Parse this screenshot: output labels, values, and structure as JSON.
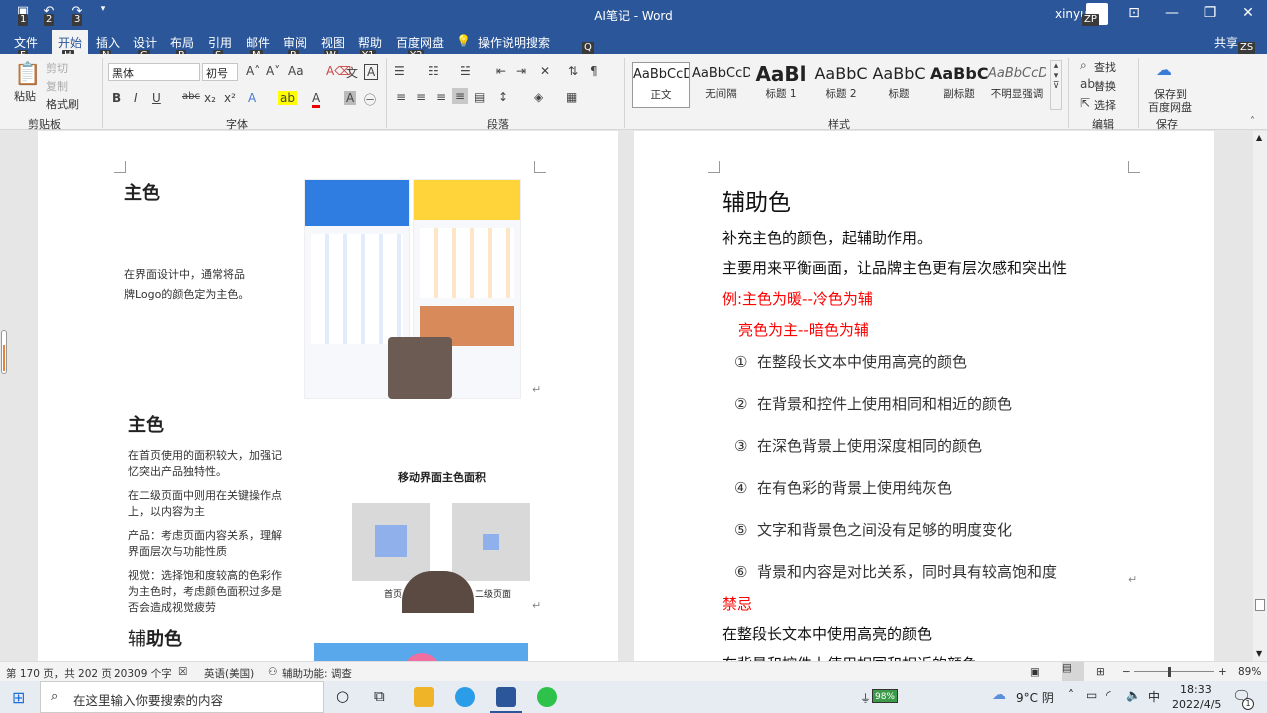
{
  "window": {
    "doc_title": "AI笔记 - Word",
    "user_name": "xinyu",
    "user_initials": "ZP"
  },
  "quick_access": {
    "keytips": [
      "1",
      "2",
      "3"
    ]
  },
  "tabs": [
    {
      "label": "文件",
      "keytip": "F"
    },
    {
      "label": "开始",
      "keytip": "H"
    },
    {
      "label": "插入",
      "keytip": "N"
    },
    {
      "label": "设计",
      "keytip": "G"
    },
    {
      "label": "布局",
      "keytip": "P"
    },
    {
      "label": "引用",
      "keytip": "S"
    },
    {
      "label": "邮件",
      "keytip": "M"
    },
    {
      "label": "审阅",
      "keytip": "R"
    },
    {
      "label": "视图",
      "keytip": "W"
    },
    {
      "label": "帮助",
      "keytip": "Y1"
    },
    {
      "label": "百度网盘",
      "keytip": "Y2"
    }
  ],
  "tell_me": {
    "label": "操作说明搜索",
    "keytip": "Q"
  },
  "share": {
    "label": "共享",
    "keytip": "ZS"
  },
  "ribbon": {
    "clipboard": {
      "group": "剪贴板",
      "paste": "粘贴",
      "cut": "剪切",
      "copy": "复制",
      "format_painter": "格式刷"
    },
    "font": {
      "group": "字体",
      "family": "黑体",
      "size": "初号"
    },
    "paragraph": {
      "group": "段落"
    },
    "styles": {
      "group": "样式",
      "items": [
        {
          "preview": "AaBbCcDd",
          "name": "正文"
        },
        {
          "preview": "AaBbCcDd",
          "name": "无间隔"
        },
        {
          "preview": "AaBl",
          "name": "标题 1"
        },
        {
          "preview": "AaBbC",
          "name": "标题 2"
        },
        {
          "preview": "AaBbC",
          "name": "标题"
        },
        {
          "preview": "AaBbC",
          "name": "副标题"
        },
        {
          "preview": "AaBbCcDd",
          "name": "不明显强调"
        }
      ]
    },
    "editing": {
      "group": "编辑",
      "find": "查找",
      "replace": "替换",
      "select": "选择"
    },
    "save": {
      "group": "保存",
      "label_line1": "保存到",
      "label_line2": "百度网盘"
    }
  },
  "page1": {
    "heading1": "主色",
    "text1_line1": "在界面设计中，通常将品",
    "text1_line2": "牌Logo的颜色定为主色。",
    "heading2": "主色",
    "p1_line1": "在首页使用的面积较大，加强记",
    "p1_line2": "忆突出产品独特性。",
    "p2_line1": "在二级页面中则用在关键操作点",
    "p2_line2": "上，以内容为主",
    "p3_line1": "产品：考虑页面内容关系，理解",
    "p3_line2": "界面层次与功能性质",
    "p4_line1": "视觉：选择饱和度较高的色彩作",
    "p4_line2": "为主色时，考虑颜色面积过多是",
    "p4_line3": "否会造成视觉疲劳",
    "diagram_title": "移动界面主色面积",
    "diagram_left_label": "首页",
    "diagram_right_label": "二级页面",
    "heading3_prefix": "辅",
    "heading3_suffix": "助色"
  },
  "page2": {
    "title": "辅助色",
    "line1": "补充主色的颜色，起辅助作用。",
    "line2": "主要用来平衡画面，让品牌主色更有层次感和突出性",
    "line3": "例:主色为暖--冷色为辅",
    "line4": "亮色为主--暗色为辅",
    "items": [
      {
        "num": "①",
        "text": "在整段长文本中使用高亮的颜色"
      },
      {
        "num": "②",
        "text": "在背景和控件上使用相同和相近的颜色"
      },
      {
        "num": "③",
        "text": "在深色背景上使用深度相同的颜色"
      },
      {
        "num": "④",
        "text": "在有色彩的背景上使用纯灰色"
      },
      {
        "num": "⑤",
        "text": "文字和背景色之间没有足够的明度变化"
      },
      {
        "num": "⑥",
        "text": "背景和内容是对比关系，同时具有较高饱和度"
      }
    ],
    "taboo": "禁忌",
    "line_after1": "在整段长文本中使用高亮的颜色",
    "line_after2": "在背景和控件上使用相同和相近的颜色",
    "red_color": "#ff0000"
  },
  "status": {
    "page": "第 170 页，共 202 页",
    "words": "20309 个字",
    "language": "英语(美国)",
    "accessibility": "辅助功能: 调查",
    "zoom": "89%"
  },
  "taskbar": {
    "search_placeholder": "在这里输入你要搜索的内容",
    "battery": "98%",
    "weather": "9°C 阴",
    "ime": "中",
    "time": "18:33",
    "date": "2022/4/5",
    "notifications": "1"
  },
  "colors": {
    "word_blue": "#2b579a",
    "red_text": "#ff0000"
  }
}
